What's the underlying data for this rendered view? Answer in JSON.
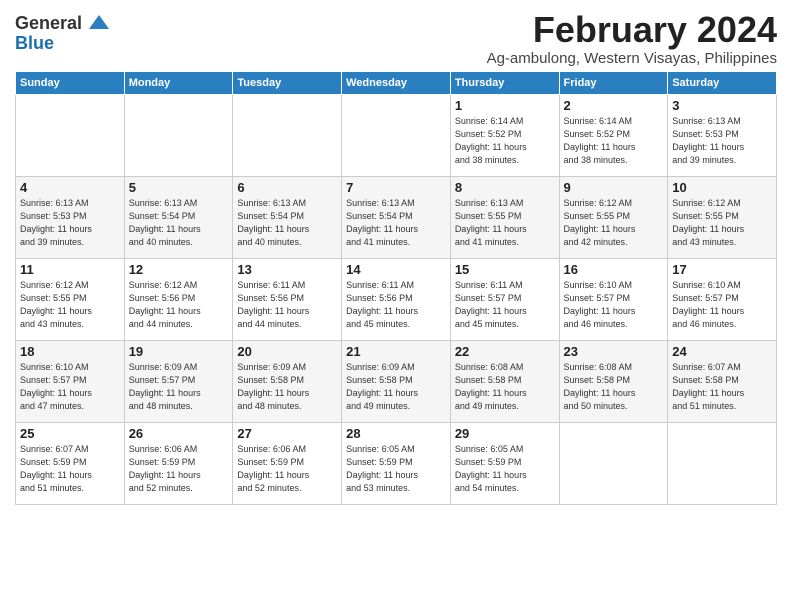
{
  "logo": {
    "general": "General",
    "blue": "Blue"
  },
  "title": "February 2024",
  "subtitle": "Ag-ambulong, Western Visayas, Philippines",
  "headers": [
    "Sunday",
    "Monday",
    "Tuesday",
    "Wednesday",
    "Thursday",
    "Friday",
    "Saturday"
  ],
  "weeks": [
    [
      {
        "num": "",
        "detail": ""
      },
      {
        "num": "",
        "detail": ""
      },
      {
        "num": "",
        "detail": ""
      },
      {
        "num": "",
        "detail": ""
      },
      {
        "num": "1",
        "detail": "Sunrise: 6:14 AM\nSunset: 5:52 PM\nDaylight: 11 hours\nand 38 minutes."
      },
      {
        "num": "2",
        "detail": "Sunrise: 6:14 AM\nSunset: 5:52 PM\nDaylight: 11 hours\nand 38 minutes."
      },
      {
        "num": "3",
        "detail": "Sunrise: 6:13 AM\nSunset: 5:53 PM\nDaylight: 11 hours\nand 39 minutes."
      }
    ],
    [
      {
        "num": "4",
        "detail": "Sunrise: 6:13 AM\nSunset: 5:53 PM\nDaylight: 11 hours\nand 39 minutes."
      },
      {
        "num": "5",
        "detail": "Sunrise: 6:13 AM\nSunset: 5:54 PM\nDaylight: 11 hours\nand 40 minutes."
      },
      {
        "num": "6",
        "detail": "Sunrise: 6:13 AM\nSunset: 5:54 PM\nDaylight: 11 hours\nand 40 minutes."
      },
      {
        "num": "7",
        "detail": "Sunrise: 6:13 AM\nSunset: 5:54 PM\nDaylight: 11 hours\nand 41 minutes."
      },
      {
        "num": "8",
        "detail": "Sunrise: 6:13 AM\nSunset: 5:55 PM\nDaylight: 11 hours\nand 41 minutes."
      },
      {
        "num": "9",
        "detail": "Sunrise: 6:12 AM\nSunset: 5:55 PM\nDaylight: 11 hours\nand 42 minutes."
      },
      {
        "num": "10",
        "detail": "Sunrise: 6:12 AM\nSunset: 5:55 PM\nDaylight: 11 hours\nand 43 minutes."
      }
    ],
    [
      {
        "num": "11",
        "detail": "Sunrise: 6:12 AM\nSunset: 5:55 PM\nDaylight: 11 hours\nand 43 minutes."
      },
      {
        "num": "12",
        "detail": "Sunrise: 6:12 AM\nSunset: 5:56 PM\nDaylight: 11 hours\nand 44 minutes."
      },
      {
        "num": "13",
        "detail": "Sunrise: 6:11 AM\nSunset: 5:56 PM\nDaylight: 11 hours\nand 44 minutes."
      },
      {
        "num": "14",
        "detail": "Sunrise: 6:11 AM\nSunset: 5:56 PM\nDaylight: 11 hours\nand 45 minutes."
      },
      {
        "num": "15",
        "detail": "Sunrise: 6:11 AM\nSunset: 5:57 PM\nDaylight: 11 hours\nand 45 minutes."
      },
      {
        "num": "16",
        "detail": "Sunrise: 6:10 AM\nSunset: 5:57 PM\nDaylight: 11 hours\nand 46 minutes."
      },
      {
        "num": "17",
        "detail": "Sunrise: 6:10 AM\nSunset: 5:57 PM\nDaylight: 11 hours\nand 46 minutes."
      }
    ],
    [
      {
        "num": "18",
        "detail": "Sunrise: 6:10 AM\nSunset: 5:57 PM\nDaylight: 11 hours\nand 47 minutes."
      },
      {
        "num": "19",
        "detail": "Sunrise: 6:09 AM\nSunset: 5:57 PM\nDaylight: 11 hours\nand 48 minutes."
      },
      {
        "num": "20",
        "detail": "Sunrise: 6:09 AM\nSunset: 5:58 PM\nDaylight: 11 hours\nand 48 minutes."
      },
      {
        "num": "21",
        "detail": "Sunrise: 6:09 AM\nSunset: 5:58 PM\nDaylight: 11 hours\nand 49 minutes."
      },
      {
        "num": "22",
        "detail": "Sunrise: 6:08 AM\nSunset: 5:58 PM\nDaylight: 11 hours\nand 49 minutes."
      },
      {
        "num": "23",
        "detail": "Sunrise: 6:08 AM\nSunset: 5:58 PM\nDaylight: 11 hours\nand 50 minutes."
      },
      {
        "num": "24",
        "detail": "Sunrise: 6:07 AM\nSunset: 5:58 PM\nDaylight: 11 hours\nand 51 minutes."
      }
    ],
    [
      {
        "num": "25",
        "detail": "Sunrise: 6:07 AM\nSunset: 5:59 PM\nDaylight: 11 hours\nand 51 minutes."
      },
      {
        "num": "26",
        "detail": "Sunrise: 6:06 AM\nSunset: 5:59 PM\nDaylight: 11 hours\nand 52 minutes."
      },
      {
        "num": "27",
        "detail": "Sunrise: 6:06 AM\nSunset: 5:59 PM\nDaylight: 11 hours\nand 52 minutes."
      },
      {
        "num": "28",
        "detail": "Sunrise: 6:05 AM\nSunset: 5:59 PM\nDaylight: 11 hours\nand 53 minutes."
      },
      {
        "num": "29",
        "detail": "Sunrise: 6:05 AM\nSunset: 5:59 PM\nDaylight: 11 hours\nand 54 minutes."
      },
      {
        "num": "",
        "detail": ""
      },
      {
        "num": "",
        "detail": ""
      }
    ]
  ]
}
